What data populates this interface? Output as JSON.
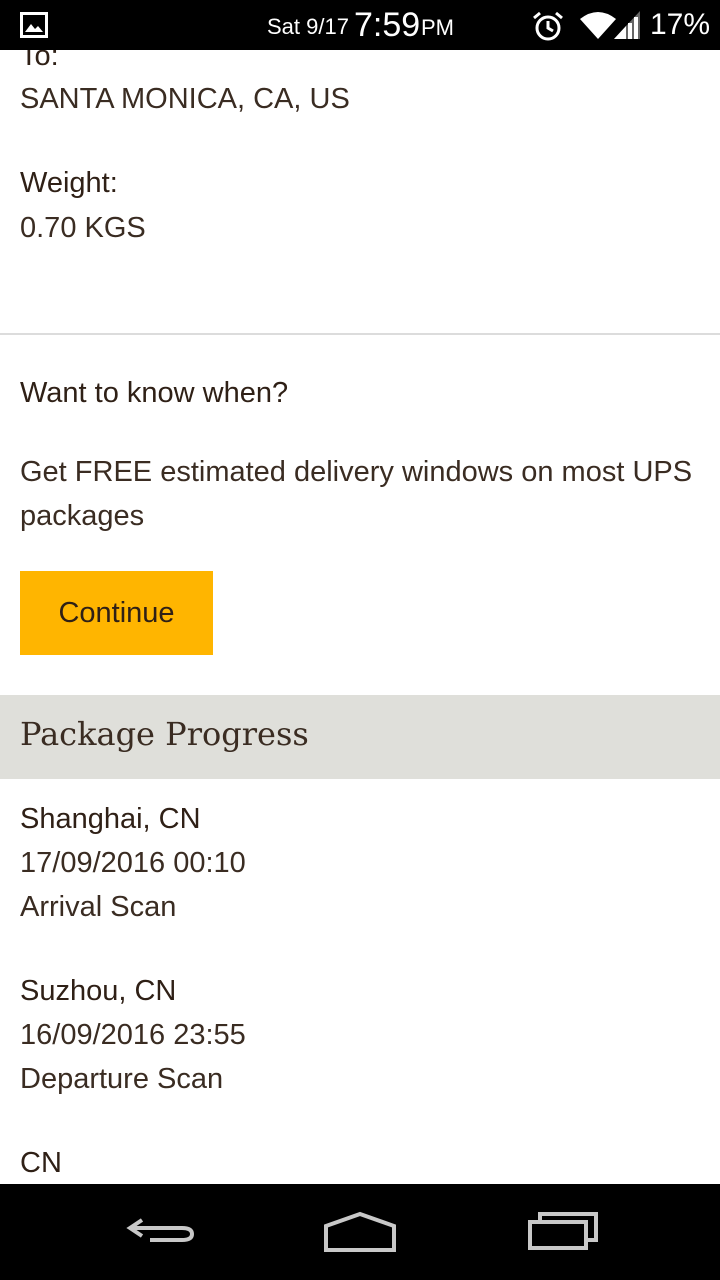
{
  "status_bar": {
    "date": "Sat 9/17",
    "time": "7:59",
    "ampm": "PM",
    "battery": "17%",
    "icons": [
      "image-notification-icon",
      "alarm-icon",
      "wifi-icon",
      "signal-icon"
    ]
  },
  "shipment": {
    "to_label": "To:",
    "to_value": "SANTA MONICA, CA, US",
    "weight_label": "Weight:",
    "weight_value": "0.70 KGS"
  },
  "promo": {
    "title": "Want to know when?",
    "text": "Get FREE estimated delivery windows on most UPS packages",
    "button_label": "Continue",
    "button_color": "#ffb500"
  },
  "progress": {
    "header": "Package Progress",
    "header_bg": "#dfdfda",
    "items": [
      {
        "location": "Shanghai, CN",
        "datetime": "17/09/2016 00:10",
        "status": "Arrival Scan"
      },
      {
        "location": "Suzhou, CN",
        "datetime": "16/09/2016 23:55",
        "status": "Departure Scan"
      },
      {
        "location": "CN",
        "datetime": "",
        "status": ""
      }
    ]
  },
  "nav_bar": {
    "icons": [
      "back-icon",
      "home-icon",
      "recent-apps-icon"
    ]
  }
}
